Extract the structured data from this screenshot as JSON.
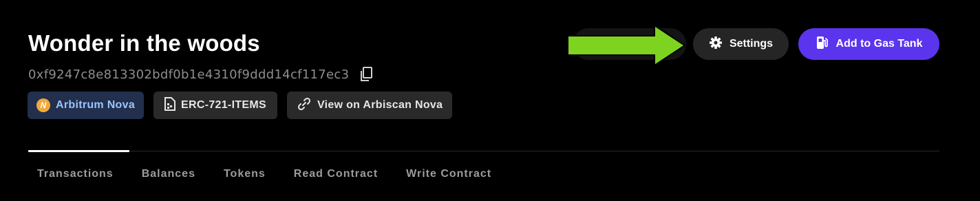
{
  "header": {
    "title": "Wonder in the woods",
    "address": "0xf9247c8e813302bdf0b1e4310f9ddd14cf117ec3",
    "copy_icon": "copy-icon"
  },
  "badges": {
    "network": "Arbitrum Nova",
    "network_logo_letter": "N",
    "standard": "ERC-721-ITEMS",
    "link": "View on Arbiscan Nova"
  },
  "actions": {
    "settings_label": "Settings",
    "settings_icon": "gear-icon",
    "gas_tank_label": "Add to Gas Tank",
    "gas_tank_icon": "fuel-pump-icon"
  },
  "annotation": {
    "arrow_color": "#7ed321"
  },
  "tabs": [
    {
      "label": "Transactions",
      "active": true
    },
    {
      "label": "Balances",
      "active": false
    },
    {
      "label": "Tokens",
      "active": false
    },
    {
      "label": "Read Contract",
      "active": false
    },
    {
      "label": "Write Contract",
      "active": false
    }
  ],
  "colors": {
    "background": "#000000",
    "accent": "#5b34ee",
    "network_badge_bg": "#22304d",
    "network_badge_text": "#9ac4ff"
  }
}
